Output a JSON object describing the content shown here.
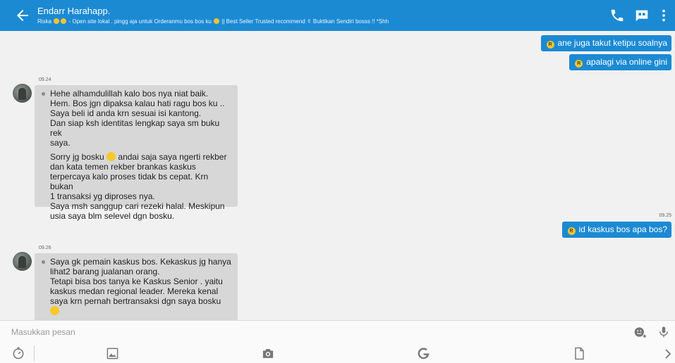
{
  "header": {
    "title": "Endarr Harahapp.",
    "subtitle_name": "Riska",
    "subtitle_text": "- Open site lokal . pingg aja untuk Orderanmu bos bos ku",
    "subtitle_text2": "|| Best Seller Trusted recommend",
    "subtitle_text3": "Buktikan Sendiri bosss !! *Shh"
  },
  "badge_letter": "R",
  "messages": {
    "out1": "ane juga takut ketipu soalnya",
    "out2": "apalagi via online gini",
    "time1": "09.24",
    "in1_p1_l1": "Hehe alhamdulillah kalo bos nya niat baik.",
    "in1_p1_l2": "Hem. Bos jgn dipaksa kalau hati ragu bos ku ..",
    "in1_p1_l3": "Saya beli id anda krn sesuai isi kantong.",
    "in1_p1_l4": "Dan siap ksh identitas lengkap saya sm buku rek",
    "in1_p1_l5": "saya.",
    "in1_p2_a": "Sorry jg bosku",
    "in1_p2_b": "andai saja saya ngerti rekber",
    "in1_p2_l2": "dan kata temen rekber brankas kaskus",
    "in1_p2_l3": "terpercaya kalo proses tidak bs cepat. Krn bukan",
    "in1_p2_l4": "1 transaksi yg diproses nya.",
    "in1_p2_l5": "Saya msh sanggup cari rezeki halal. Meskipun",
    "in1_p2_l6": "usia saya blm selevel dgn bosku.",
    "time2": "09.25",
    "out3": "id kaskus bos apa bos?",
    "time3": "09.26",
    "in2_l1": "Saya gk pemain kaskus bos. Kekaskus jg hanya",
    "in2_l2": "lihat2 barang jualanan orang.",
    "in2_l3": "Tetapi bisa bos tanya ke Kaskus Senior . yaitu",
    "in2_l4": "kaskus medan regional leader. Mereka kenal",
    "in2_l5": "saya krn pernah bertransaksi dgn saya bosku"
  },
  "input": {
    "placeholder": "Masukkan pesan"
  },
  "colors": {
    "header": "#1b8ad3",
    "outgoing_bubble": "#1b8ad3",
    "incoming_bubble": "#d7d7d7",
    "background": "#f1f1f1"
  },
  "icons": {
    "back": "arrow-left-icon",
    "call": "phone-icon",
    "chat": "chat-bubble-icon",
    "menu": "more-vert-icon",
    "emoji": "emoji-add-icon",
    "mic": "microphone-icon",
    "timer": "timer-icon",
    "gallery": "image-icon",
    "camera": "camera-icon",
    "google": "google-icon",
    "file": "file-icon",
    "next": "chevron-right-icon"
  }
}
